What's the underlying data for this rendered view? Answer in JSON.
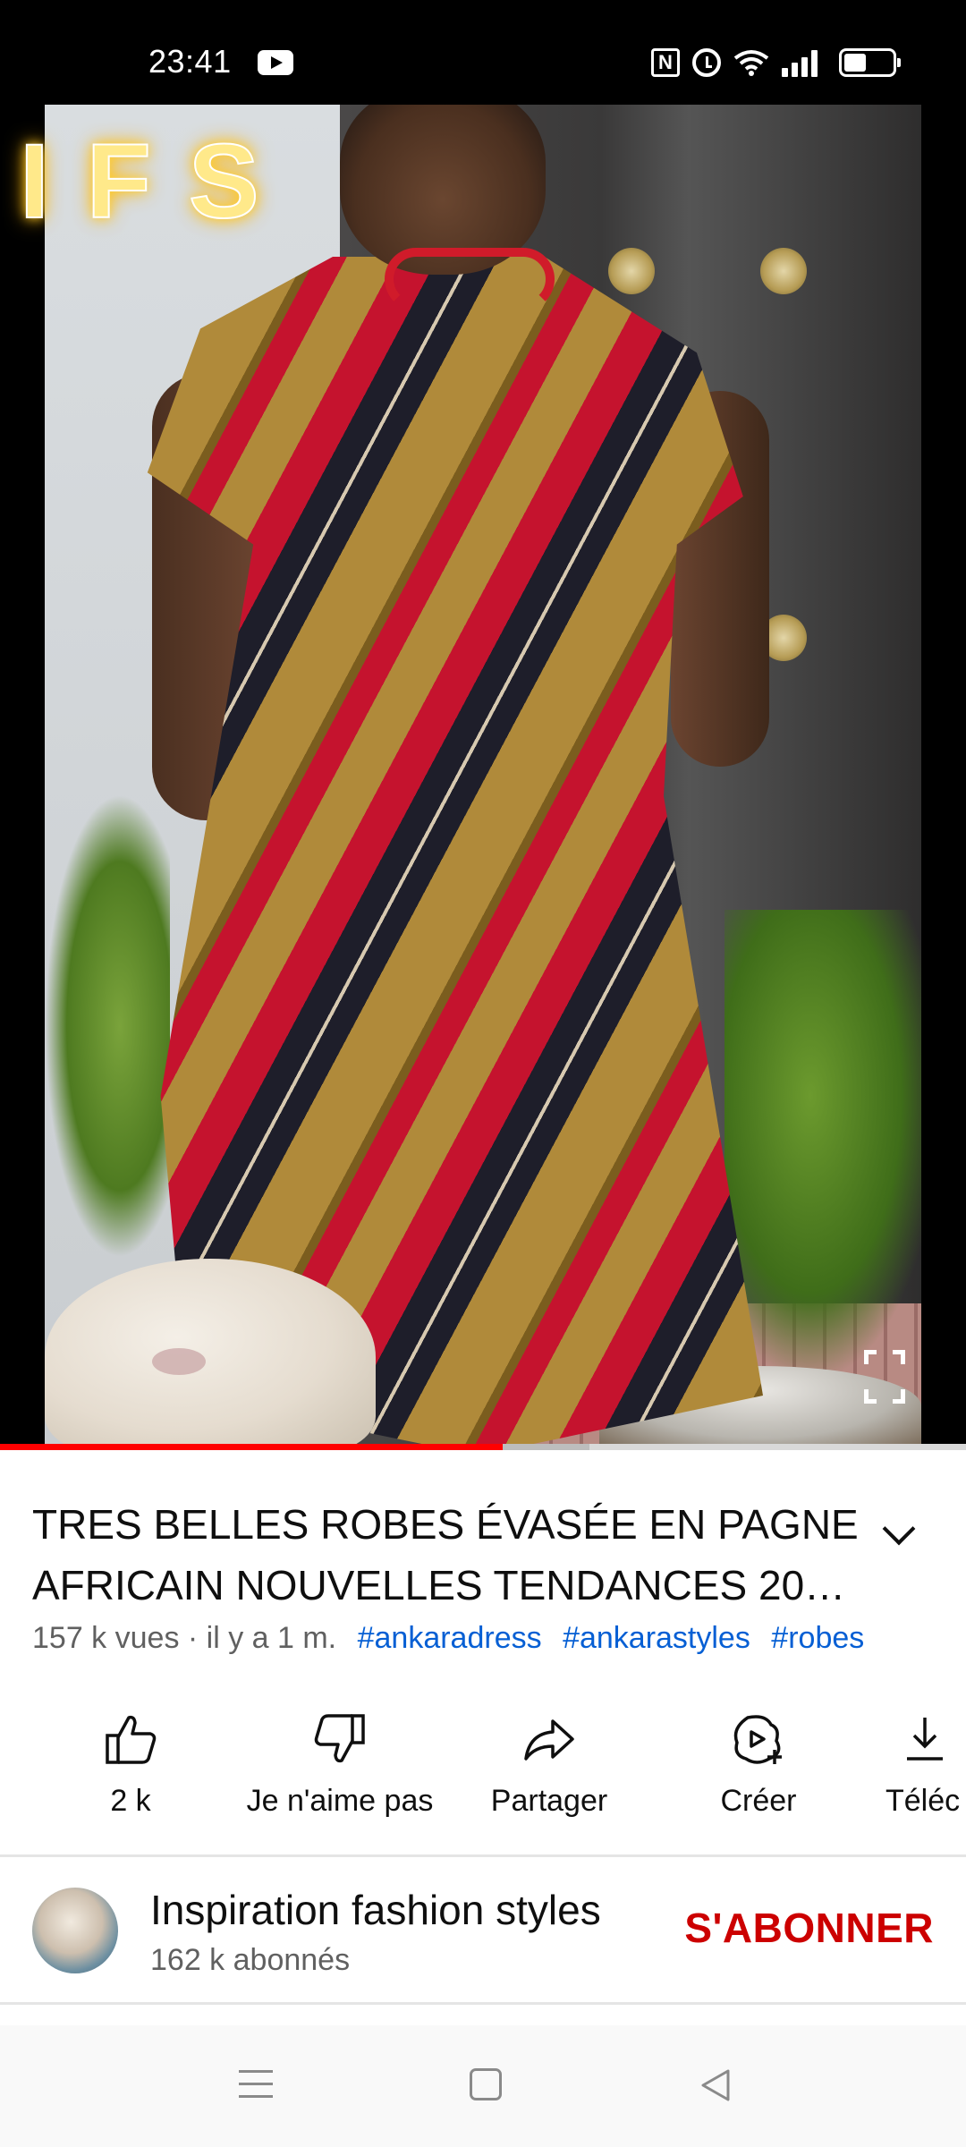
{
  "status_bar": {
    "time": "23:41",
    "icons": [
      "youtube-icon",
      "nfc-icon",
      "alarm-icon",
      "wifi-icon",
      "signal-icon",
      "battery-icon"
    ]
  },
  "video": {
    "watermark_text": "IFS",
    "progress_fraction": 0.52,
    "buffer_fraction": 0.09,
    "colors": {
      "progress": "#ff0000",
      "buffer": "#bdbdbd",
      "track": "#d9d9d9"
    }
  },
  "title": {
    "text": "TRES BELLES ROBES ÉVASÉE EN PAGNE AFRICAIN NOUVELLES TENDANCES 20…"
  },
  "meta": {
    "views": "157 k vues · il y a 1 m.",
    "hashtags": [
      "#ankaradress",
      "#ankarastyles",
      "#robes"
    ]
  },
  "actions": [
    {
      "icon": "thumbs-up-icon",
      "label": "2 k"
    },
    {
      "icon": "thumbs-down-icon",
      "label": "Je n'aime pas"
    },
    {
      "icon": "share-icon",
      "label": "Partager"
    },
    {
      "icon": "create-icon",
      "label": "Créer"
    },
    {
      "icon": "download-icon",
      "label": "Téléc"
    }
  ],
  "channel": {
    "name": "Inspiration fashion styles",
    "subscribers": "162 k abonnés",
    "subscribe_label": "S'ABONNER",
    "subscribe_color": "#cc0000"
  },
  "nav_bar": {
    "buttons": [
      "menu-icon",
      "home-icon",
      "back-icon"
    ]
  }
}
